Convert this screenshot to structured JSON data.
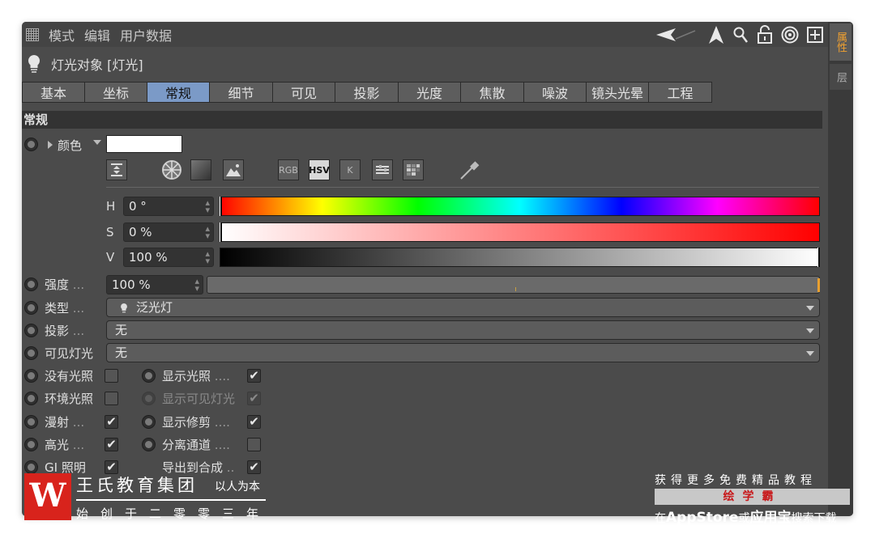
{
  "menu": {
    "items": [
      "模式",
      "编辑",
      "用户数据"
    ]
  },
  "side_tabs": {
    "active": "属性",
    "second": "层"
  },
  "object_title": "灯光对象 [灯光]",
  "tabs": [
    "基本",
    "坐标",
    "常规",
    "细节",
    "可见",
    "投影",
    "光度",
    "焦散",
    "噪波",
    "镜头光晕",
    "工程"
  ],
  "active_tab": "常规",
  "section": "常规",
  "color": {
    "label": "颜色",
    "value": "#ffffff"
  },
  "color_modes": {
    "rgb": "RGB",
    "hsv": "HSV",
    "k": "K"
  },
  "hsv": {
    "h": {
      "label": "H",
      "value": "0 °"
    },
    "s": {
      "label": "S",
      "value": "0 %"
    },
    "v": {
      "label": "V",
      "value": "100 %"
    }
  },
  "intensity": {
    "label": "强度",
    "value": "100 %"
  },
  "type": {
    "label": "类型",
    "value": "泛光灯"
  },
  "shadow": {
    "label": "投影",
    "value": "无"
  },
  "visible_light": {
    "label": "可见灯光",
    "value": "无"
  },
  "checks": {
    "no_light": {
      "label": "没有光照",
      "checked": false
    },
    "ambient": {
      "label": "环境光照",
      "checked": false
    },
    "diffuse": {
      "label": "漫射",
      "checked": true
    },
    "specular": {
      "label": "高光",
      "checked": true
    },
    "gi": {
      "label": "GI 照明",
      "checked": true
    },
    "show_light": {
      "label": "显示光照",
      "checked": true
    },
    "show_visible": {
      "label": "显示可见灯光",
      "checked": true
    },
    "show_clip": {
      "label": "显示修剪",
      "checked": true
    },
    "separate_pass": {
      "label": "分离通道",
      "checked": false
    },
    "export_comp": {
      "label": "导出到合成",
      "checked": true
    }
  },
  "dots": "....",
  "check_mark": "✔",
  "watermark": {
    "logo": "W",
    "title": "王氏教育集团",
    "sub": "以人为本",
    "slogan": "始创于二零零三年",
    "promo_line1": "获得更多免费精品教程",
    "promo_brand": "绘学霸",
    "promo_line2_a": "在",
    "promo_line2_b": "AppStore",
    "promo_line2_c": "或",
    "promo_line2_d": "应用宝",
    "promo_line2_e": "搜索下载"
  }
}
